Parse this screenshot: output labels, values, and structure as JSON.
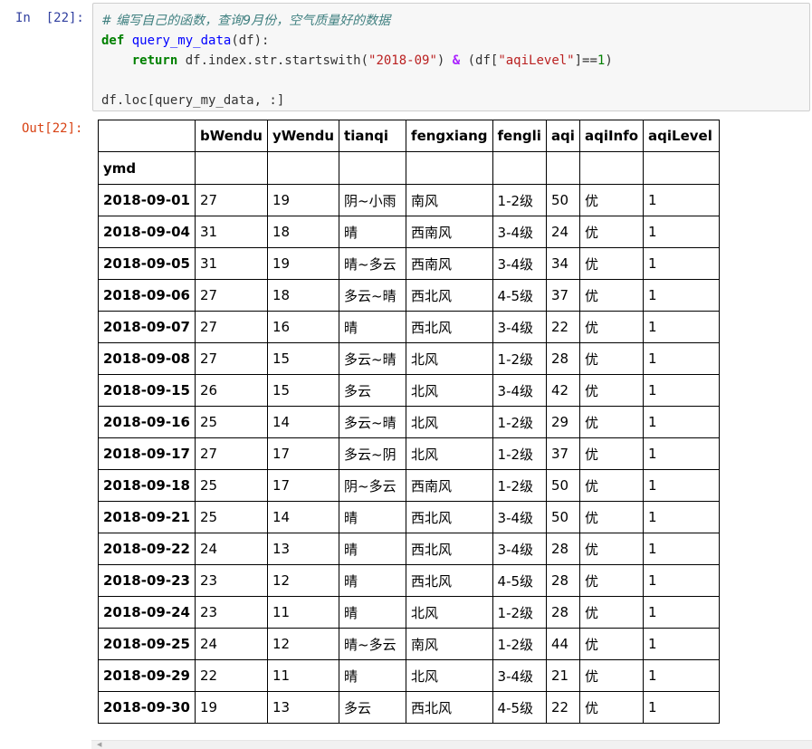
{
  "input_cell": {
    "prompt": "In  [22]:",
    "comment": "# 编写自己的函数，查询9月份，空气质量好的数据",
    "def_kw": "def",
    "func_name": "query_my_data",
    "params": "(df):",
    "return_kw": "return",
    "expr_1": " df.index.str.startswith(",
    "str_1": "\"2018-09\"",
    "expr_2": ") ",
    "op_and": "&",
    "expr_3": " (df[",
    "str_2": "\"aqiLevel\"",
    "expr_4": "]==",
    "num_1": "1",
    "expr_5": ")",
    "call_line": "df.loc[query_my_data, :]"
  },
  "output_cell": {
    "prompt": "Out[22]:",
    "table": {
      "columns": [
        "bWendu",
        "yWendu",
        "tianqi",
        "fengxiang",
        "fengli",
        "aqi",
        "aqiInfo",
        "aqiLevel"
      ],
      "index_name": "ymd",
      "rows": [
        {
          "index": "2018-09-01",
          "values": [
            "27",
            "19",
            "阴~小雨",
            "南风",
            "1-2级",
            "50",
            "优",
            "1"
          ]
        },
        {
          "index": "2018-09-04",
          "values": [
            "31",
            "18",
            "晴",
            "西南风",
            "3-4级",
            "24",
            "优",
            "1"
          ]
        },
        {
          "index": "2018-09-05",
          "values": [
            "31",
            "19",
            "晴~多云",
            "西南风",
            "3-4级",
            "34",
            "优",
            "1"
          ]
        },
        {
          "index": "2018-09-06",
          "values": [
            "27",
            "18",
            "多云~晴",
            "西北风",
            "4-5级",
            "37",
            "优",
            "1"
          ]
        },
        {
          "index": "2018-09-07",
          "values": [
            "27",
            "16",
            "晴",
            "西北风",
            "3-4级",
            "22",
            "优",
            "1"
          ]
        },
        {
          "index": "2018-09-08",
          "values": [
            "27",
            "15",
            "多云~晴",
            "北风",
            "1-2级",
            "28",
            "优",
            "1"
          ]
        },
        {
          "index": "2018-09-15",
          "values": [
            "26",
            "15",
            "多云",
            "北风",
            "3-4级",
            "42",
            "优",
            "1"
          ]
        },
        {
          "index": "2018-09-16",
          "values": [
            "25",
            "14",
            "多云~晴",
            "北风",
            "1-2级",
            "29",
            "优",
            "1"
          ]
        },
        {
          "index": "2018-09-17",
          "values": [
            "27",
            "17",
            "多云~阴",
            "北风",
            "1-2级",
            "37",
            "优",
            "1"
          ]
        },
        {
          "index": "2018-09-18",
          "values": [
            "25",
            "17",
            "阴~多云",
            "西南风",
            "1-2级",
            "50",
            "优",
            "1"
          ]
        },
        {
          "index": "2018-09-21",
          "values": [
            "25",
            "14",
            "晴",
            "西北风",
            "3-4级",
            "50",
            "优",
            "1"
          ]
        },
        {
          "index": "2018-09-22",
          "values": [
            "24",
            "13",
            "晴",
            "西北风",
            "3-4级",
            "28",
            "优",
            "1"
          ]
        },
        {
          "index": "2018-09-23",
          "values": [
            "23",
            "12",
            "晴",
            "西北风",
            "4-5级",
            "28",
            "优",
            "1"
          ]
        },
        {
          "index": "2018-09-24",
          "values": [
            "23",
            "11",
            "晴",
            "北风",
            "1-2级",
            "28",
            "优",
            "1"
          ]
        },
        {
          "index": "2018-09-25",
          "values": [
            "24",
            "12",
            "晴~多云",
            "南风",
            "1-2级",
            "44",
            "优",
            "1"
          ]
        },
        {
          "index": "2018-09-29",
          "values": [
            "22",
            "11",
            "晴",
            "北风",
            "3-4级",
            "21",
            "优",
            "1"
          ]
        },
        {
          "index": "2018-09-30",
          "values": [
            "19",
            "13",
            "多云",
            "西北风",
            "4-5级",
            "22",
            "优",
            "1"
          ]
        }
      ]
    }
  },
  "colors": {
    "in_prompt": "#303f9f",
    "out_prompt": "#d84315",
    "code_bg": "#f7f7f7",
    "keyword": "#008000",
    "string": "#ba2121",
    "comment": "#408080",
    "function_name": "#0000ff"
  }
}
